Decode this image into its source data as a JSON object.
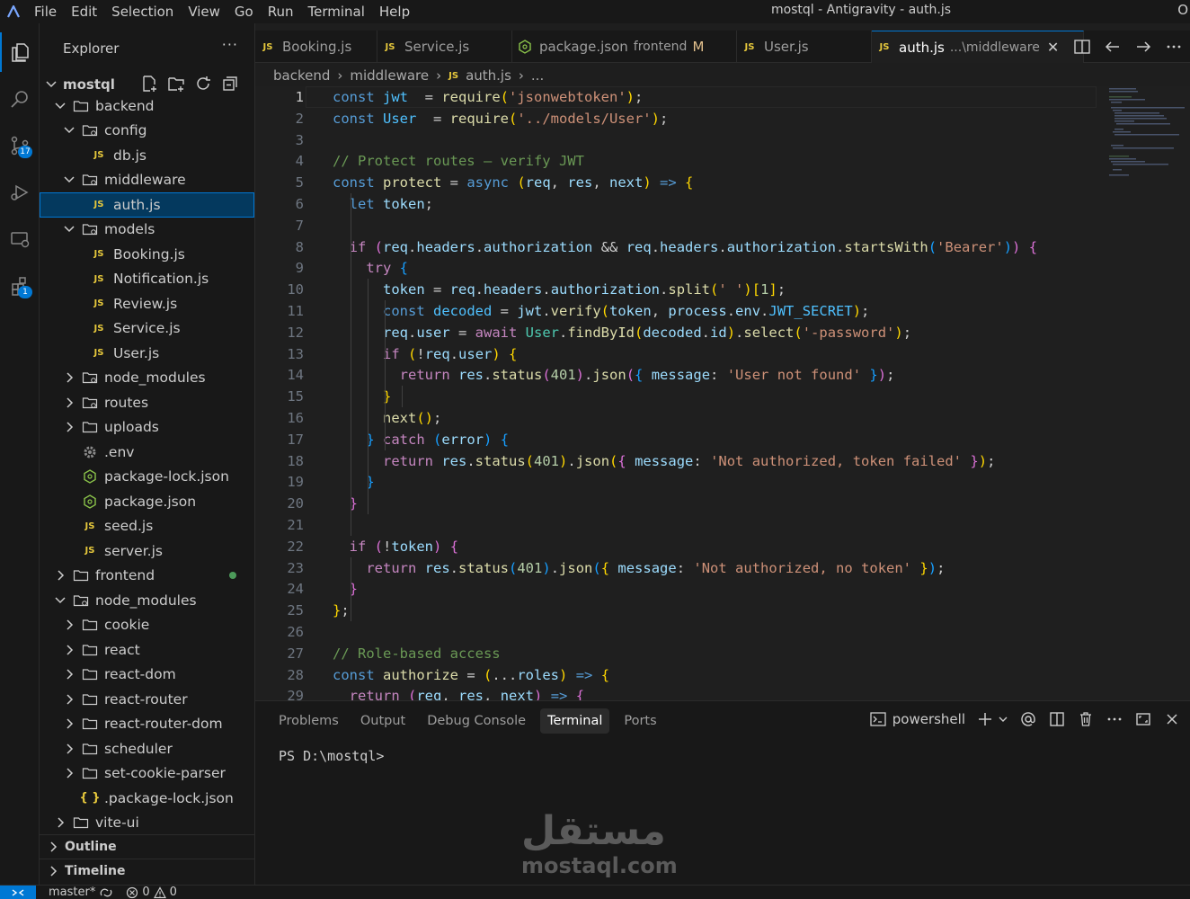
{
  "titlebar": {
    "menu": [
      "File",
      "Edit",
      "Selection",
      "View",
      "Go",
      "Run",
      "Terminal",
      "Help"
    ],
    "title": "mostql - Antigravity - auth.js",
    "right_text": "O"
  },
  "activitybar": {
    "scm_badge": "17",
    "extensions_badge": "1"
  },
  "sidebar": {
    "header": "Explorer",
    "more": "···",
    "root": "mostql",
    "tree": [
      {
        "label": "backend",
        "type": "folder",
        "depth": 1,
        "open": true
      },
      {
        "label": "config",
        "type": "folder-special",
        "depth": 2,
        "open": true
      },
      {
        "label": "db.js",
        "type": "js",
        "depth": 3
      },
      {
        "label": "middleware",
        "type": "folder-special",
        "depth": 2,
        "open": true
      },
      {
        "label": "auth.js",
        "type": "js",
        "depth": 3,
        "selected": true
      },
      {
        "label": "models",
        "type": "folder-special",
        "depth": 2,
        "open": true
      },
      {
        "label": "Booking.js",
        "type": "js",
        "depth": 3
      },
      {
        "label": "Notification.js",
        "type": "js",
        "depth": 3
      },
      {
        "label": "Review.js",
        "type": "js",
        "depth": 3
      },
      {
        "label": "Service.js",
        "type": "js",
        "depth": 3
      },
      {
        "label": "User.js",
        "type": "js",
        "depth": 3
      },
      {
        "label": "node_modules",
        "type": "folder-special",
        "depth": 2,
        "open": false
      },
      {
        "label": "routes",
        "type": "folder-special",
        "depth": 2,
        "open": false
      },
      {
        "label": "uploads",
        "type": "folder",
        "depth": 2,
        "open": false
      },
      {
        "label": ".env",
        "type": "gear",
        "depth": 2
      },
      {
        "label": "package-lock.json",
        "type": "json",
        "depth": 2
      },
      {
        "label": "package.json",
        "type": "json",
        "depth": 2
      },
      {
        "label": "seed.js",
        "type": "js",
        "depth": 2
      },
      {
        "label": "server.js",
        "type": "js",
        "depth": 2
      },
      {
        "label": "frontend",
        "type": "folder",
        "depth": 1,
        "open": false,
        "green": true
      },
      {
        "label": "node_modules",
        "type": "folder-special",
        "depth": 1,
        "open": true
      },
      {
        "label": "cookie",
        "type": "folder",
        "depth": 2,
        "open": false
      },
      {
        "label": "react",
        "type": "folder",
        "depth": 2,
        "open": false
      },
      {
        "label": "react-dom",
        "type": "folder",
        "depth": 2,
        "open": false
      },
      {
        "label": "react-router",
        "type": "folder",
        "depth": 2,
        "open": false
      },
      {
        "label": "react-router-dom",
        "type": "folder",
        "depth": 2,
        "open": false
      },
      {
        "label": "scheduler",
        "type": "folder",
        "depth": 2,
        "open": false
      },
      {
        "label": "set-cookie-parser",
        "type": "folder",
        "depth": 2,
        "open": false
      },
      {
        "label": ".package-lock.json",
        "type": "brace",
        "depth": 2
      },
      {
        "label": "vite-ui",
        "type": "folder",
        "depth": 1,
        "open": false
      }
    ],
    "outline": "Outline",
    "timeline": "Timeline"
  },
  "tabs": [
    {
      "label": "Booking.js",
      "type": "js"
    },
    {
      "label": "Service.js",
      "type": "js"
    },
    {
      "label": "package.json",
      "type": "json",
      "desc": "frontend",
      "mod": "M"
    },
    {
      "label": "User.js",
      "type": "js"
    },
    {
      "label": "auth.js",
      "type": "js",
      "desc": "...\\middleware",
      "active": true,
      "close": "✕"
    }
  ],
  "breadcrumb": {
    "parts": [
      "backend",
      "middleware",
      "auth.js",
      "..."
    ]
  },
  "editor": {
    "lines": [
      [
        [
          "kw",
          "const "
        ],
        [
          "const",
          "jwt"
        ],
        [
          "",
          "  = "
        ],
        [
          "fn",
          "require"
        ],
        [
          "p1",
          "("
        ],
        [
          "str",
          "'jsonwebtoken'"
        ],
        [
          "p1",
          ")"
        ],
        [
          "",
          ";"
        ]
      ],
      [
        [
          "kw",
          "const "
        ],
        [
          "const",
          "User"
        ],
        [
          "",
          "  = "
        ],
        [
          "fn",
          "require"
        ],
        [
          "p1",
          "("
        ],
        [
          "str",
          "'../models/User'"
        ],
        [
          "p1",
          ")"
        ],
        [
          "",
          ";"
        ]
      ],
      [],
      [
        [
          "cmt",
          "// Protect routes — verify JWT"
        ]
      ],
      [
        [
          "kw",
          "const "
        ],
        [
          "fn",
          "protect"
        ],
        [
          "",
          " = "
        ],
        [
          "kw",
          "async "
        ],
        [
          "p1",
          "("
        ],
        [
          "var",
          "req"
        ],
        [
          "",
          ", "
        ],
        [
          "var",
          "res"
        ],
        [
          "",
          ", "
        ],
        [
          "var",
          "next"
        ],
        [
          "p1",
          ")"
        ],
        [
          "",
          " "
        ],
        [
          "kw",
          "=>"
        ],
        [
          "",
          " "
        ],
        [
          "p1",
          "{"
        ]
      ],
      [
        [
          "",
          "  "
        ],
        [
          "kw",
          "let "
        ],
        [
          "var",
          "token"
        ],
        [
          "",
          ";"
        ]
      ],
      [],
      [
        [
          "",
          "  "
        ],
        [
          "ctrl",
          "if "
        ],
        [
          "p2",
          "("
        ],
        [
          "var",
          "req"
        ],
        [
          "",
          "."
        ],
        [
          "var",
          "headers"
        ],
        [
          "",
          "."
        ],
        [
          "var",
          "authorization"
        ],
        [
          "",
          " && "
        ],
        [
          "var",
          "req"
        ],
        [
          "",
          "."
        ],
        [
          "var",
          "headers"
        ],
        [
          "",
          "."
        ],
        [
          "var",
          "authorization"
        ],
        [
          "",
          "."
        ],
        [
          "fn",
          "startsWith"
        ],
        [
          "p3",
          "("
        ],
        [
          "str",
          "'Bearer'"
        ],
        [
          "p3",
          ")"
        ],
        [
          "p2",
          ")"
        ],
        [
          "",
          " "
        ],
        [
          "p2",
          "{"
        ]
      ],
      [
        [
          "",
          "    "
        ],
        [
          "ctrl",
          "try "
        ],
        [
          "p3",
          "{"
        ]
      ],
      [
        [
          "",
          "      "
        ],
        [
          "var",
          "token"
        ],
        [
          "",
          " = "
        ],
        [
          "var",
          "req"
        ],
        [
          "",
          "."
        ],
        [
          "var",
          "headers"
        ],
        [
          "",
          "."
        ],
        [
          "var",
          "authorization"
        ],
        [
          "",
          "."
        ],
        [
          "fn",
          "split"
        ],
        [
          "p1",
          "("
        ],
        [
          "str",
          "' '"
        ],
        [
          "p1",
          ")"
        ],
        [
          "p1",
          "["
        ],
        [
          "num",
          "1"
        ],
        [
          "p1",
          "]"
        ],
        [
          "",
          ";"
        ]
      ],
      [
        [
          "",
          "      "
        ],
        [
          "kw",
          "const "
        ],
        [
          "const",
          "decoded"
        ],
        [
          "",
          " = "
        ],
        [
          "var",
          "jwt"
        ],
        [
          "",
          "."
        ],
        [
          "fn",
          "verify"
        ],
        [
          "p1",
          "("
        ],
        [
          "var",
          "token"
        ],
        [
          "",
          ", "
        ],
        [
          "var",
          "process"
        ],
        [
          "",
          "."
        ],
        [
          "var",
          "env"
        ],
        [
          "",
          "."
        ],
        [
          "const",
          "JWT_SECRET"
        ],
        [
          "p1",
          ")"
        ],
        [
          "",
          ";"
        ]
      ],
      [
        [
          "",
          "      "
        ],
        [
          "var",
          "req"
        ],
        [
          "",
          "."
        ],
        [
          "var",
          "user"
        ],
        [
          "",
          " = "
        ],
        [
          "ctrl",
          "await "
        ],
        [
          "cls",
          "User"
        ],
        [
          "",
          "."
        ],
        [
          "fn",
          "findById"
        ],
        [
          "p1",
          "("
        ],
        [
          "var",
          "decoded"
        ],
        [
          "",
          "."
        ],
        [
          "var",
          "id"
        ],
        [
          "p1",
          ")"
        ],
        [
          "",
          "."
        ],
        [
          "fn",
          "select"
        ],
        [
          "p1",
          "("
        ],
        [
          "str",
          "'-password'"
        ],
        [
          "p1",
          ")"
        ],
        [
          "",
          ";"
        ]
      ],
      [
        [
          "",
          "      "
        ],
        [
          "ctrl",
          "if "
        ],
        [
          "p1",
          "("
        ],
        [
          "",
          "!"
        ],
        [
          "var",
          "req"
        ],
        [
          "",
          "."
        ],
        [
          "var",
          "user"
        ],
        [
          "p1",
          ")"
        ],
        [
          "",
          " "
        ],
        [
          "p1",
          "{"
        ]
      ],
      [
        [
          "",
          "        "
        ],
        [
          "ctrl",
          "return "
        ],
        [
          "var",
          "res"
        ],
        [
          "",
          "."
        ],
        [
          "fn",
          "status"
        ],
        [
          "p2",
          "("
        ],
        [
          "num",
          "401"
        ],
        [
          "p2",
          ")"
        ],
        [
          "",
          "."
        ],
        [
          "fn",
          "json"
        ],
        [
          "p2",
          "("
        ],
        [
          "p3",
          "{"
        ],
        [
          "",
          " "
        ],
        [
          "var",
          "message"
        ],
        [
          "",
          ": "
        ],
        [
          "str",
          "'User not found'"
        ],
        [
          "",
          " "
        ],
        [
          "p3",
          "}"
        ],
        [
          "p2",
          ")"
        ],
        [
          "",
          ";"
        ]
      ],
      [
        [
          "",
          "      "
        ],
        [
          "p1",
          "}"
        ]
      ],
      [
        [
          "",
          "      "
        ],
        [
          "fn",
          "next"
        ],
        [
          "p1",
          "("
        ],
        [
          "p1",
          ")"
        ],
        [
          "",
          ";"
        ]
      ],
      [
        [
          "",
          "    "
        ],
        [
          "p3",
          "}"
        ],
        [
          "",
          " "
        ],
        [
          "ctrl",
          "catch "
        ],
        [
          "p3",
          "("
        ],
        [
          "var",
          "error"
        ],
        [
          "p3",
          ")"
        ],
        [
          "",
          " "
        ],
        [
          "p3",
          "{"
        ]
      ],
      [
        [
          "",
          "      "
        ],
        [
          "ctrl",
          "return "
        ],
        [
          "var",
          "res"
        ],
        [
          "",
          "."
        ],
        [
          "fn",
          "status"
        ],
        [
          "p1",
          "("
        ],
        [
          "num",
          "401"
        ],
        [
          "p1",
          ")"
        ],
        [
          "",
          "."
        ],
        [
          "fn",
          "json"
        ],
        [
          "p1",
          "("
        ],
        [
          "p2",
          "{"
        ],
        [
          "",
          " "
        ],
        [
          "var",
          "message"
        ],
        [
          "",
          ": "
        ],
        [
          "str",
          "'Not authorized, token failed'"
        ],
        [
          "",
          " "
        ],
        [
          "p2",
          "}"
        ],
        [
          "p1",
          ")"
        ],
        [
          "",
          ";"
        ]
      ],
      [
        [
          "",
          "    "
        ],
        [
          "p3",
          "}"
        ]
      ],
      [
        [
          "",
          "  "
        ],
        [
          "p2",
          "}"
        ]
      ],
      [],
      [
        [
          "",
          "  "
        ],
        [
          "ctrl",
          "if "
        ],
        [
          "p2",
          "("
        ],
        [
          "",
          "!"
        ],
        [
          "var",
          "token"
        ],
        [
          "p2",
          ")"
        ],
        [
          "",
          " "
        ],
        [
          "p2",
          "{"
        ]
      ],
      [
        [
          "",
          "    "
        ],
        [
          "ctrl",
          "return "
        ],
        [
          "var",
          "res"
        ],
        [
          "",
          "."
        ],
        [
          "fn",
          "status"
        ],
        [
          "p3",
          "("
        ],
        [
          "num",
          "401"
        ],
        [
          "p3",
          ")"
        ],
        [
          "",
          "."
        ],
        [
          "fn",
          "json"
        ],
        [
          "p3",
          "("
        ],
        [
          "p1",
          "{"
        ],
        [
          "",
          " "
        ],
        [
          "var",
          "message"
        ],
        [
          "",
          ": "
        ],
        [
          "str",
          "'Not authorized, no token'"
        ],
        [
          "",
          " "
        ],
        [
          "p1",
          "}"
        ],
        [
          "p3",
          ")"
        ],
        [
          "",
          ";"
        ]
      ],
      [
        [
          "",
          "  "
        ],
        [
          "p2",
          "}"
        ]
      ],
      [
        [
          "p1",
          "}"
        ],
        [
          "",
          ";"
        ]
      ],
      [],
      [
        [
          "cmt",
          "// Role-based access"
        ]
      ],
      [
        [
          "kw",
          "const "
        ],
        [
          "fn",
          "authorize"
        ],
        [
          "",
          " = "
        ],
        [
          "p1",
          "("
        ],
        [
          "",
          "..."
        ],
        [
          "var",
          "roles"
        ],
        [
          "p1",
          ")"
        ],
        [
          "",
          " "
        ],
        [
          "kw",
          "=>"
        ],
        [
          "",
          " "
        ],
        [
          "p1",
          "{"
        ]
      ],
      [
        [
          "",
          "  "
        ],
        [
          "ctrl",
          "return "
        ],
        [
          "p2",
          "("
        ],
        [
          "var",
          "req"
        ],
        [
          "",
          ", "
        ],
        [
          "var",
          "res"
        ],
        [
          "",
          ", "
        ],
        [
          "var",
          "next"
        ],
        [
          "p2",
          ")"
        ],
        [
          "",
          " "
        ],
        [
          "kw",
          "=>"
        ],
        [
          "",
          " "
        ],
        [
          "p2",
          "{"
        ]
      ]
    ]
  },
  "panel": {
    "tabs": [
      "Problems",
      "Output",
      "Debug Console",
      "Terminal",
      "Ports"
    ],
    "active_tab": "Terminal",
    "shell": "powershell",
    "prompt": "PS D:\\mostql>",
    "watermark_ar": "مستقل",
    "watermark_en": "mostaql.com"
  },
  "statusbar": {
    "branch": "master*",
    "errors": "0",
    "warnings": "0"
  },
  "colors": {
    "accent": "#0078d4",
    "selection": "#04395e"
  }
}
